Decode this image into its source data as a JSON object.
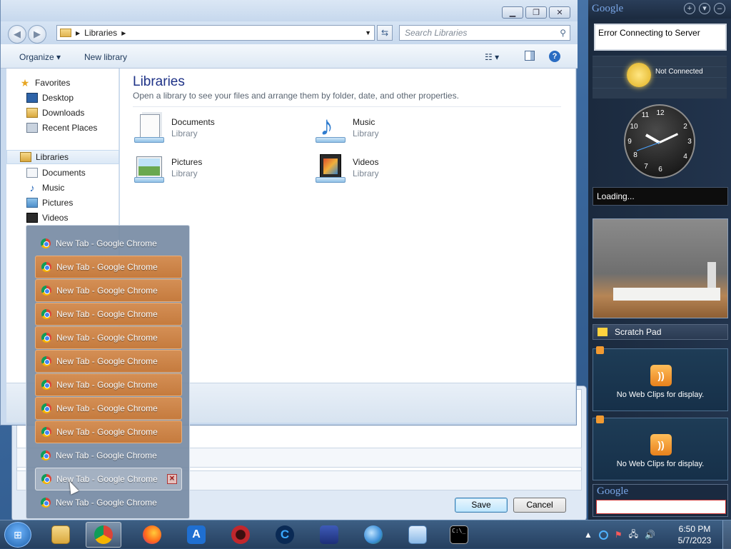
{
  "explorer": {
    "breadcrumb": "Libraries",
    "search_placeholder": "Search Libraries",
    "toolbar": {
      "organize": "Organize ▾",
      "new_library": "New library"
    },
    "nav": {
      "favorites": "Favorites",
      "favorite_items": [
        "Desktop",
        "Downloads",
        "Recent Places"
      ],
      "libraries": "Libraries",
      "library_items": [
        "Documents",
        "Music",
        "Pictures",
        "Videos"
      ]
    },
    "content": {
      "title": "Libraries",
      "subtitle": "Open a library to see your files and arrange them by folder, date, and other properties.",
      "libraries": [
        {
          "name": "Documents",
          "type": "Library",
          "icon": "documents-library-icon"
        },
        {
          "name": "Music",
          "type": "Library",
          "icon": "music-library-icon"
        },
        {
          "name": "Pictures",
          "type": "Library",
          "icon": "pictures-library-icon"
        },
        {
          "name": "Videos",
          "type": "Library",
          "icon": "videos-library-icon"
        }
      ]
    }
  },
  "save_dialog": {
    "save_label": "Save",
    "cancel_label": "Cancel"
  },
  "thumbnail_list": {
    "items": [
      {
        "label": "New Tab - Google Chrome",
        "state": "normal"
      },
      {
        "label": "New Tab - Google Chrome",
        "state": "highlight"
      },
      {
        "label": "New Tab - Google Chrome",
        "state": "highlight"
      },
      {
        "label": "New Tab - Google Chrome",
        "state": "highlight"
      },
      {
        "label": "New Tab - Google Chrome",
        "state": "highlight"
      },
      {
        "label": "New Tab - Google Chrome",
        "state": "highlight"
      },
      {
        "label": "New Tab - Google Chrome",
        "state": "highlight"
      },
      {
        "label": "New Tab - Google Chrome",
        "state": "highlight"
      },
      {
        "label": "New Tab - Google Chrome",
        "state": "highlight"
      },
      {
        "label": "New Tab - Google Chrome",
        "state": "normal"
      },
      {
        "label": "New Tab - Google Chrome",
        "state": "hover"
      },
      {
        "label": "New Tab - Google Chrome",
        "state": "normal"
      }
    ]
  },
  "sidebar": {
    "header_logo": "Google",
    "error_text": "Error Connecting to Server",
    "weather_status": "Not Connected",
    "loading_text": "Loading...",
    "scratch_pad": "Scratch Pad",
    "web_clips_message": "No Web Clips for display.",
    "search_logo": "Google"
  },
  "taskbar": {
    "apps": [
      "windows-explorer-icon",
      "chrome-icon",
      "firefox-icon",
      "a-app-icon",
      "opera-icon",
      "c-app-icon",
      "shield-app-icon",
      "globe-app-icon",
      "network-app-icon",
      "cmd-icon"
    ],
    "time": "6:50 PM",
    "date": "5/7/2023"
  },
  "colors": {
    "accent": "#1e3287",
    "highlight": "#c57b3e",
    "taskbar": "#253f5f"
  }
}
